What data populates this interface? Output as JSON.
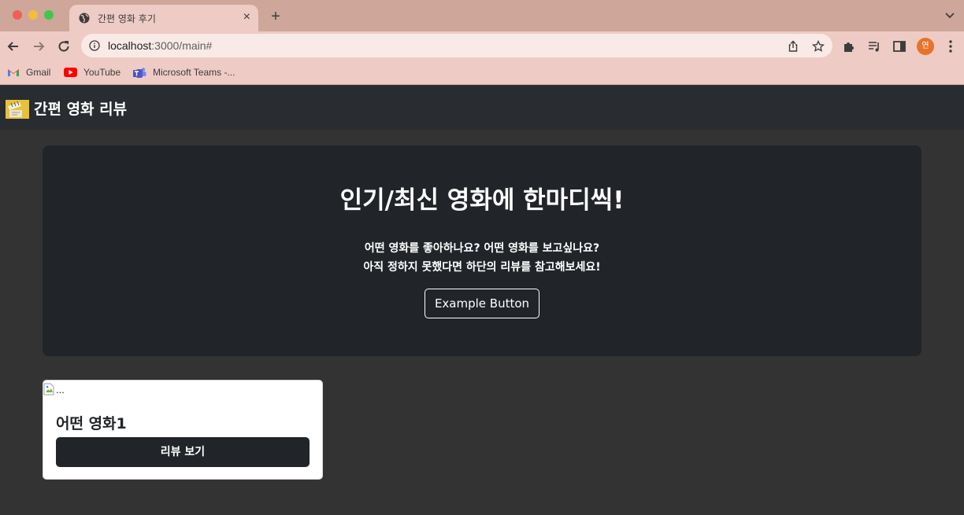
{
  "browser": {
    "tab_title": "간편 영화 후기",
    "tab_close": "×",
    "new_tab": "+",
    "url_host": "localhost",
    "url_path": ":3000/main#",
    "profile_initial": "연",
    "bookmarks": [
      {
        "label": "Gmail",
        "icon": "gmail-icon"
      },
      {
        "label": "YouTube",
        "icon": "youtube-icon"
      },
      {
        "label": "Microsoft Teams -...",
        "icon": "teams-icon"
      }
    ]
  },
  "navbar": {
    "brand": "간편 영화 리뷰",
    "logo_icon": "clapperboard-icon"
  },
  "hero": {
    "title": "인기/최신 영화에 한마디씩!",
    "line1": "어떤 영화를 좋아하나요? 어떤 영화를 보고싶나요?",
    "line2": "아직 정하지 못했다면 하단의 리뷰를 참고해보세요!",
    "button_label": "Example Button"
  },
  "cards": [
    {
      "image_alt": "...",
      "title": "어떤 영화1",
      "button_label": "리뷰 보기"
    }
  ],
  "colors": {
    "tab_strip": "#cfa69a",
    "toolbar": "#eecbc4",
    "navbar": "#292c30",
    "page_bg": "#333333",
    "hero_bg": "#212428",
    "card_button": "#212529"
  }
}
